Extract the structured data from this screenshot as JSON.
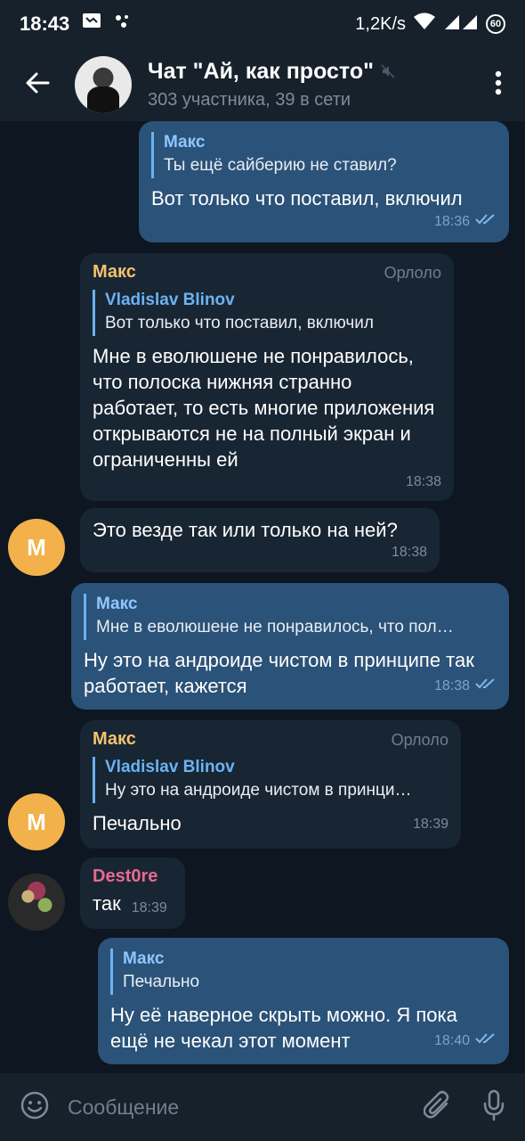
{
  "status_bar": {
    "time": "18:43",
    "network_speed": "1,2K/s",
    "battery": "60"
  },
  "header": {
    "title": "Чат \"Ай, как просто\"",
    "subtitle": "303 участника, 39 в сети"
  },
  "messages": [
    {
      "direction": "out",
      "reply_name": "Макс",
      "reply_text": "Ты ещё сайберию не ставил?",
      "text": "Вот только что поставил, включил",
      "time": "18:36"
    },
    {
      "direction": "in",
      "sender": "Макс",
      "sender_tag": "Орлоло",
      "reply_name": "Vladislav Blinov",
      "reply_text": "Вот только что поставил, включил",
      "text": "Мне в еволюшене не понравилось, что полоска нижняя странно работает, то есть многие приложения открываются не на полный экран и ограниченны ей",
      "time": "18:38"
    },
    {
      "direction": "in",
      "avatar_letter": "М",
      "text": "Это везде так или только на ней?",
      "time": "18:38"
    },
    {
      "direction": "out",
      "reply_name": "Макс",
      "reply_text": "Мне в еволюшене не понравилось, что пол…",
      "text": "Ну это на андроиде чистом в принципе так работает, кажется",
      "time": "18:38"
    },
    {
      "direction": "in",
      "sender": "Макс",
      "sender_tag": "Орлоло",
      "avatar_letter": "М",
      "reply_name": "Vladislav Blinov",
      "reply_text": "Ну это на андроиде чистом в принци…",
      "text": "Печально",
      "time": "18:39"
    },
    {
      "direction": "in",
      "sender": "Dest0re",
      "text": "так",
      "time": "18:39"
    },
    {
      "direction": "out",
      "reply_name": "Макс",
      "reply_text": "Печально",
      "text": "Ну её наверное скрыть можно. Я пока ещё не чекал этот момент",
      "time": "18:40"
    }
  ],
  "input": {
    "placeholder": "Сообщение"
  },
  "colors": {
    "background": "#0e1621",
    "bar": "#17212b",
    "outgoing_bubble": "#2b5278",
    "incoming_bubble": "#182533",
    "sender_maks": "#f5c26b",
    "sender_dest": "#e66a8e",
    "reply_accent": "#6ab3f3"
  },
  "icons": [
    "back-arrow-icon",
    "muted-icon",
    "more-vert-icon",
    "emoji-icon",
    "attach-icon",
    "mic-icon",
    "double-check-icon",
    "wifi-icon",
    "signal-icon",
    "battery-icon",
    "message-icon",
    "dots-icon"
  ]
}
